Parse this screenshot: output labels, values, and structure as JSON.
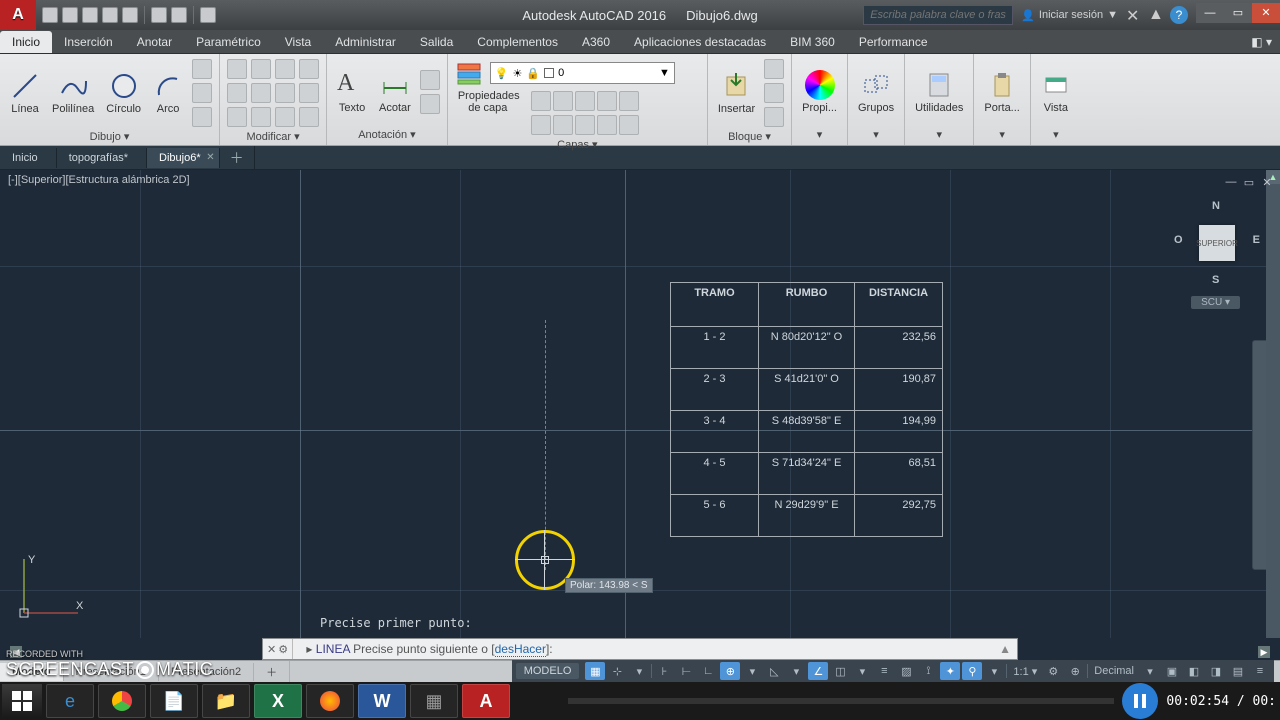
{
  "title": {
    "app": "Autodesk AutoCAD 2016",
    "file": "Dibujo6.dwg"
  },
  "search_placeholder": "Escriba palabra clave o frase",
  "signin": "Iniciar sesión",
  "menu_tabs": [
    "Inicio",
    "Inserción",
    "Anotar",
    "Paramétrico",
    "Vista",
    "Administrar",
    "Salida",
    "Complementos",
    "A360",
    "Aplicaciones destacadas",
    "BIM 360",
    "Performance"
  ],
  "ribbon": {
    "dibujo": {
      "label": "Dibujo ▾",
      "linea": "Línea",
      "polilinea": "Polilínea",
      "circulo": "Círculo",
      "arco": "Arco"
    },
    "modificar": {
      "label": "Modificar ▾"
    },
    "anotacion": {
      "label": "Anotación ▾",
      "texto": "Texto",
      "acotar": "Acotar"
    },
    "capas": {
      "label": "Capas ▾",
      "props": "Propiedades de capa",
      "layer0": "0"
    },
    "bloque": {
      "label": "Bloque ▾",
      "insertar": "Insertar"
    },
    "propiedades": "Propi...",
    "grupos": "Grupos",
    "utilidades": "Utilidades",
    "portapapeles": "Porta...",
    "vista": "Vista"
  },
  "file_tabs": {
    "tab1": "Inicio",
    "tab2": "topografías*",
    "tab3": "Dibujo6*"
  },
  "viewport_label": "[-][Superior][Estructura alámbrica 2D]",
  "viewcube": {
    "n": "N",
    "s": "S",
    "e": "E",
    "o": "O",
    "face": "SUPERIOR",
    "ucs": "SCU ▾"
  },
  "polar_tip": "Polar: 143.98 < S",
  "prompt_above": "Precise primer punto:",
  "command": {
    "cmd": "LINEA",
    "text1": " Precise punto siguiente o [",
    "opt": "desHacer",
    "text2": "]:"
  },
  "survey": {
    "headers": {
      "h1": "TRAMO",
      "h2": "RUMBO",
      "h3": "DISTANCIA"
    },
    "rows": [
      {
        "tramo": "1 - 2",
        "rumbo": "N 80d20'12\" O",
        "dist": "232,56"
      },
      {
        "tramo": "2 - 3",
        "rumbo": "S 41d21'0\" O",
        "dist": "190,87"
      },
      {
        "tramo": "3 - 4",
        "rumbo": "S 48d39'58\" E",
        "dist": "194,99"
      },
      {
        "tramo": "4 - 5",
        "rumbo": "S 71d34'24\" E",
        "dist": "68,51"
      },
      {
        "tramo": "5 - 6",
        "rumbo": "N 29d29'9\" E",
        "dist": "292,75"
      }
    ]
  },
  "layout_tabs": {
    "t1": "Modelo",
    "t2": "Presentación1",
    "t3": "Presentación2"
  },
  "status": {
    "modelo": "MODELO",
    "scale": "1:1 ▾",
    "units": "Decimal"
  },
  "recording": {
    "line1": "RECORDED WITH",
    "line2": "SCREENCAST    MATIC",
    "time": "00:02:54 / 00:"
  }
}
